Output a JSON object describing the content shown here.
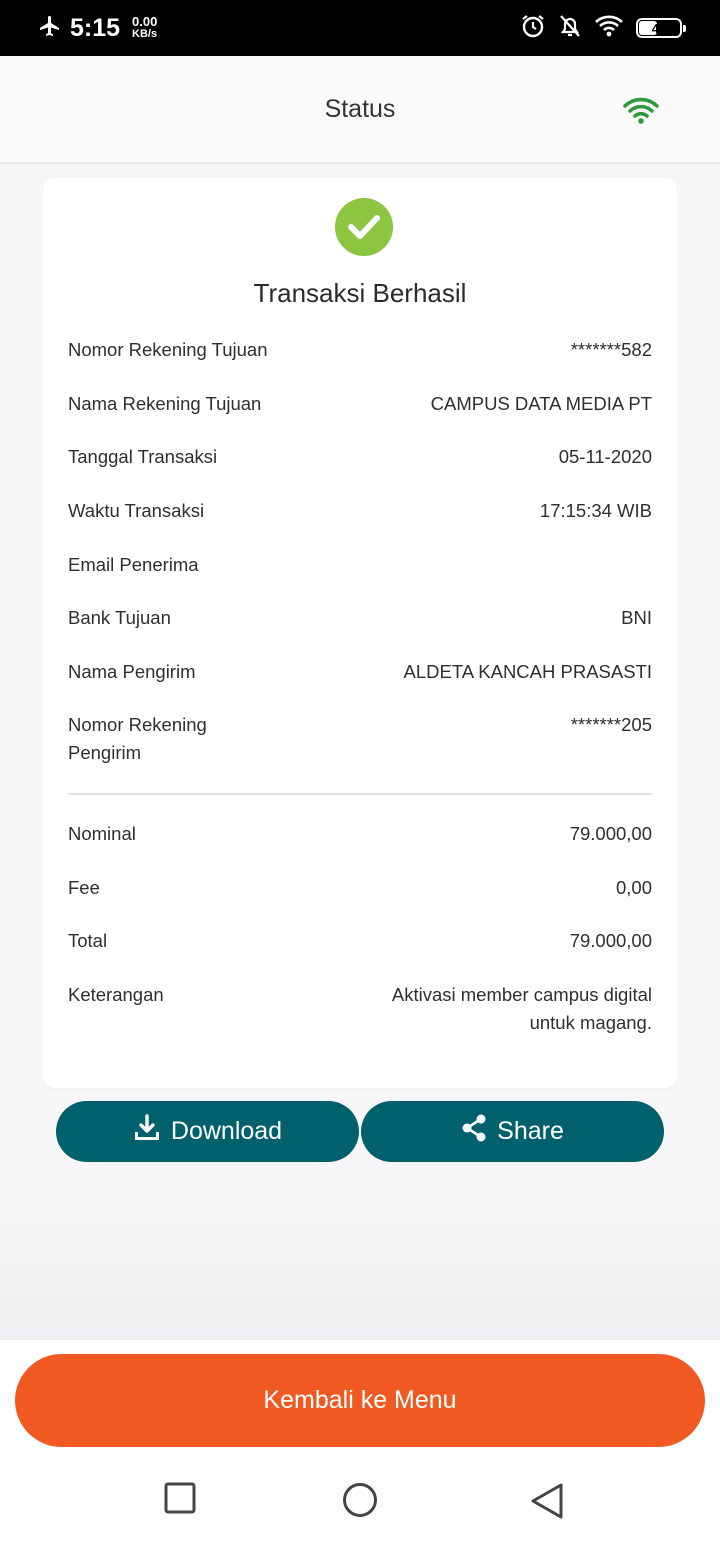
{
  "statusbar": {
    "time": "5:15",
    "speed_value": "0.00",
    "speed_unit": "KB/s",
    "battery": "43"
  },
  "appbar": {
    "title": "Status",
    "connection_color": "#2e9a3a"
  },
  "card": {
    "status_title": "Transaksi Berhasil",
    "details": [
      {
        "label": "Nomor Rekening Tujuan",
        "value": "*******582"
      },
      {
        "label": "Nama Rekening Tujuan",
        "value": "CAMPUS DATA MEDIA PT"
      },
      {
        "label": "Tanggal Transaksi",
        "value": "05-11-2020"
      },
      {
        "label": "Waktu Transaksi",
        "value": "17:15:34 WIB"
      },
      {
        "label": "Email Penerima",
        "value": ""
      },
      {
        "label": "Bank Tujuan",
        "value": "BNI"
      },
      {
        "label": "Nama Pengirim",
        "value": "ALDETA KANCAH PRASASTI"
      },
      {
        "label": "Nomor Rekening Pengirim",
        "value": "*******205"
      }
    ],
    "amounts": [
      {
        "label": "Nominal",
        "value": "79.000,00"
      },
      {
        "label": "Fee",
        "value": "0,00"
      },
      {
        "label": "Total",
        "value": "79.000,00"
      },
      {
        "label": "Keterangan",
        "value": "Aktivasi member campus digital untuk magang."
      }
    ]
  },
  "actions": {
    "download_label": "Download",
    "share_label": "Share",
    "back_label": "Kembali ke Menu"
  },
  "colors": {
    "success": "#8cc540",
    "primary": "#00606b",
    "accent": "#f05a22"
  }
}
